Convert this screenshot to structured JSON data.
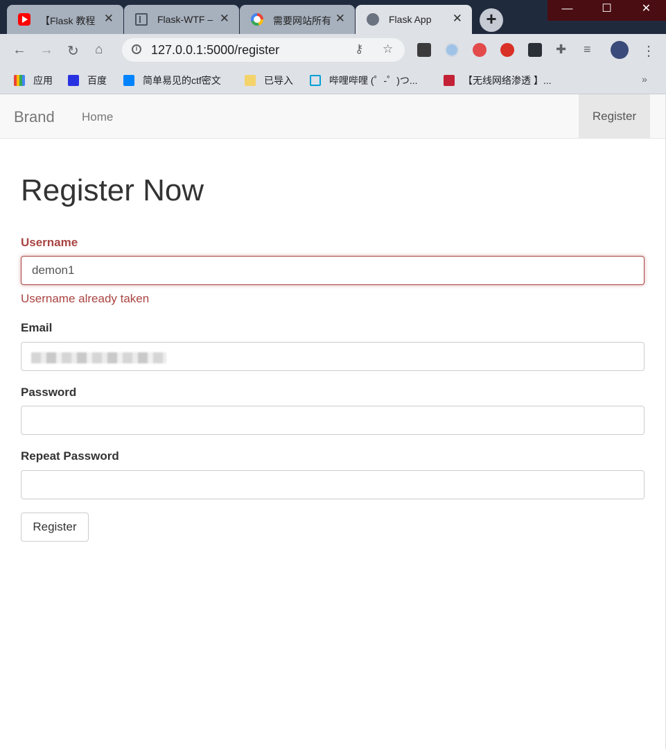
{
  "browser": {
    "tabs": [
      {
        "title": "【Flask 教程",
        "icon": "youtube-icon"
      },
      {
        "title": "Flask-WTF –",
        "icon": "document-icon"
      },
      {
        "title": "需要网站所有",
        "icon": "google-icon"
      },
      {
        "title": "Flask App",
        "icon": "globe-icon",
        "active": true
      }
    ],
    "window_controls": {
      "minimize": "—",
      "maximize": "☐",
      "close": "✕"
    },
    "url": "127.0.0.1:5000/register",
    "bookmarks": [
      {
        "label": "应用",
        "icon": "apps-grid-icon"
      },
      {
        "label": "百度",
        "icon": "baidu-icon"
      },
      {
        "label": "简单易见的ctf密文",
        "icon": "zhihu-icon"
      },
      {
        "label": "已导入",
        "icon": "folder-icon"
      },
      {
        "label": "哔哩哔哩 (゜-゜)つ...",
        "icon": "bilibili-icon"
      },
      {
        "label": "【无线网络渗透 】...",
        "icon": "csdn-icon"
      }
    ],
    "bookmarks_overflow": "»"
  },
  "navbar": {
    "brand": "Brand",
    "home": "Home",
    "register": "Register"
  },
  "form": {
    "title": "Register Now",
    "username_label": "Username",
    "username_value": "demon1",
    "username_error": "Username already taken",
    "email_label": "Email",
    "password_label": "Password",
    "repeat_password_label": "Repeat Password",
    "submit_label": "Register"
  },
  "colors": {
    "error": "#a94442",
    "navbar_bg": "#f8f8f8",
    "tab_strip_bg": "#202a3d"
  }
}
